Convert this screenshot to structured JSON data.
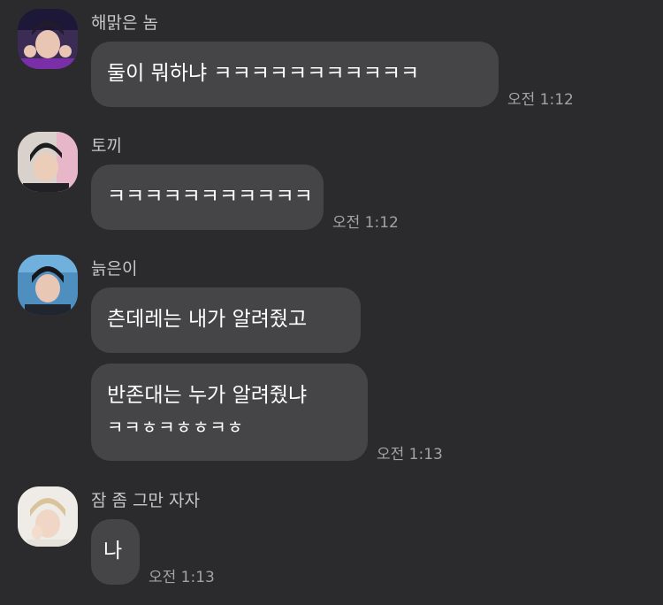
{
  "messages": [
    {
      "sender": "해맑은 놈",
      "avatar_icon": "avatar-purple-headband",
      "bubbles": [
        {
          "lines": [
            "둘이 뭐하냐 ㅋㅋㅋㅋㅋㅋㅋㅋㅋㅋㅋ"
          ]
        }
      ],
      "time": "오전 1:12"
    },
    {
      "sender": "토끼",
      "avatar_icon": "avatar-dark-hair",
      "bubbles": [
        {
          "lines": [
            "ㅋㅋㅋㅋㅋㅋㅋㅋㅋㅋㅋ"
          ]
        }
      ],
      "time": "오전 1:12"
    },
    {
      "sender": "늙은이",
      "avatar_icon": "avatar-blue-background",
      "bubbles": [
        {
          "lines": [
            "츤데레는 내가 알려줬고"
          ]
        },
        {
          "lines": [
            "반존대는 누가 알려줬냐",
            "ㅋㅋㅎㅋㅎㅎㅋㅎ"
          ]
        }
      ],
      "time": "오전 1:13"
    },
    {
      "sender": "잠 좀 그만 자자",
      "avatar_icon": "avatar-blonde-hair",
      "bubbles": [
        {
          "lines": [
            "나"
          ]
        }
      ],
      "time": "오전 1:13"
    }
  ],
  "colors": {
    "background": "#2b2b2d",
    "bubble": "#454548",
    "sender_text": "#c7c7c9",
    "time_text": "#a3a3a6"
  }
}
